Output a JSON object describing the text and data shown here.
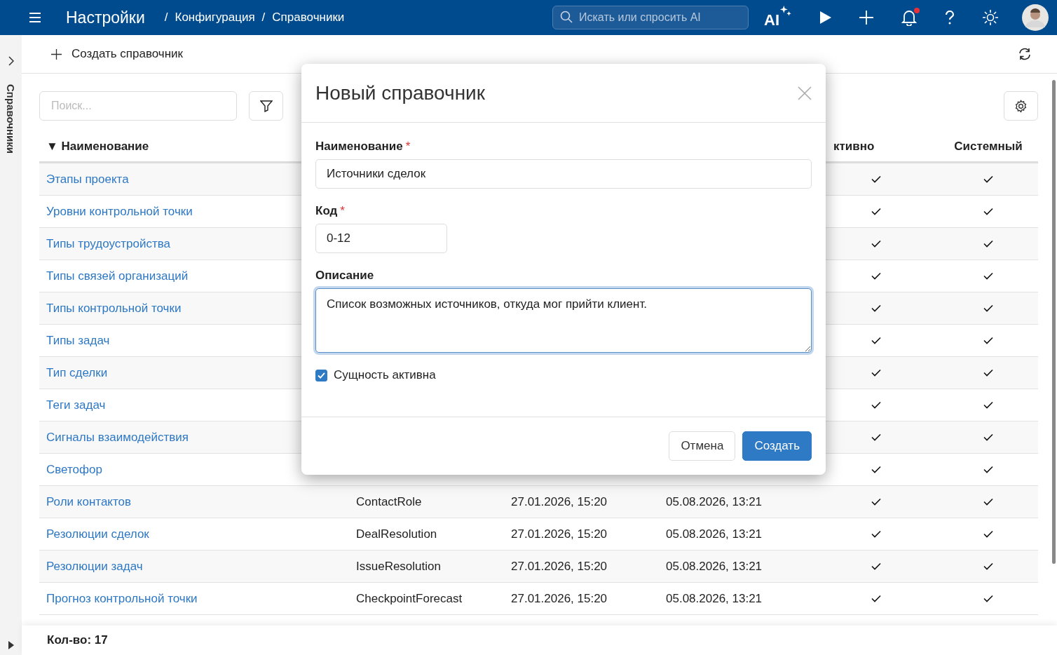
{
  "header": {
    "title": "Настройки",
    "breadcrumbs": [
      {
        "separator": "/",
        "label": "Конфигурация"
      },
      {
        "separator": "/",
        "label": "Справочники"
      }
    ],
    "search": {
      "placeholder": "Искать или спросить AI"
    },
    "ai_label": "AI",
    "notification_dot": true
  },
  "side_rail": {
    "label": "Справочники"
  },
  "toolbar": {
    "create_label": "Создать справочник"
  },
  "filter": {
    "placeholder": "Поиск..."
  },
  "table": {
    "columns": [
      "Наименование",
      "ктивно",
      "Системный"
    ],
    "sort_mark": "▼",
    "rows": [
      {
        "name": "Этапы проекта",
        "active": true,
        "system": true
      },
      {
        "name": "Уровни контрольной точки",
        "active": true,
        "system": true
      },
      {
        "name": "Типы трудоустройства",
        "active": true,
        "system": true
      },
      {
        "name": "Типы связей организаций",
        "active": true,
        "system": true
      },
      {
        "name": "Типы контрольной точки",
        "active": true,
        "system": true
      },
      {
        "name": "Типы задач",
        "active": true,
        "system": true
      },
      {
        "name": "Тип сделки",
        "active": true,
        "system": true
      },
      {
        "name": "Теги задач",
        "active": true,
        "system": true
      },
      {
        "name": "Сигналы взаимодействия",
        "active": true,
        "system": true
      },
      {
        "name": "Светофор",
        "active": true,
        "system": true
      },
      {
        "name": "Роли контактов",
        "code": "ContactRole",
        "created": "27.01.2026, 15:20",
        "updated": "05.08.2026, 13:21",
        "active": true,
        "system": true
      },
      {
        "name": "Резолюции сделок",
        "code": "DealResolution",
        "created": "27.01.2026, 15:20",
        "updated": "05.08.2026, 13:21",
        "active": true,
        "system": true
      },
      {
        "name": "Резолюции задач",
        "code": "IssueResolution",
        "created": "27.01.2026, 15:20",
        "updated": "05.08.2026, 13:21",
        "active": true,
        "system": true
      },
      {
        "name": "Прогноз контрольной точки",
        "code": "CheckpointForecast",
        "created": "27.01.2026, 15:20",
        "updated": "05.08.2026, 13:21",
        "active": true,
        "system": true
      }
    ]
  },
  "footer": {
    "count": "Кол-во: 17"
  },
  "dialog": {
    "title": "Новый справочник",
    "name_field": {
      "label": "Наименование",
      "required_mark": "*",
      "value": "Источники сделок"
    },
    "code_field": {
      "label": "Код",
      "required_mark": "*",
      "value": "0-12"
    },
    "description_field": {
      "label": "Описание",
      "value": "Список возможных источников, откуда мог прийти клиент."
    },
    "active_checkbox": {
      "label": "Сущность активна",
      "checked": true
    },
    "buttons": [
      {
        "label": "Отмена",
        "kind": "secondary"
      },
      {
        "label": "Создать",
        "kind": "primary"
      }
    ]
  }
}
